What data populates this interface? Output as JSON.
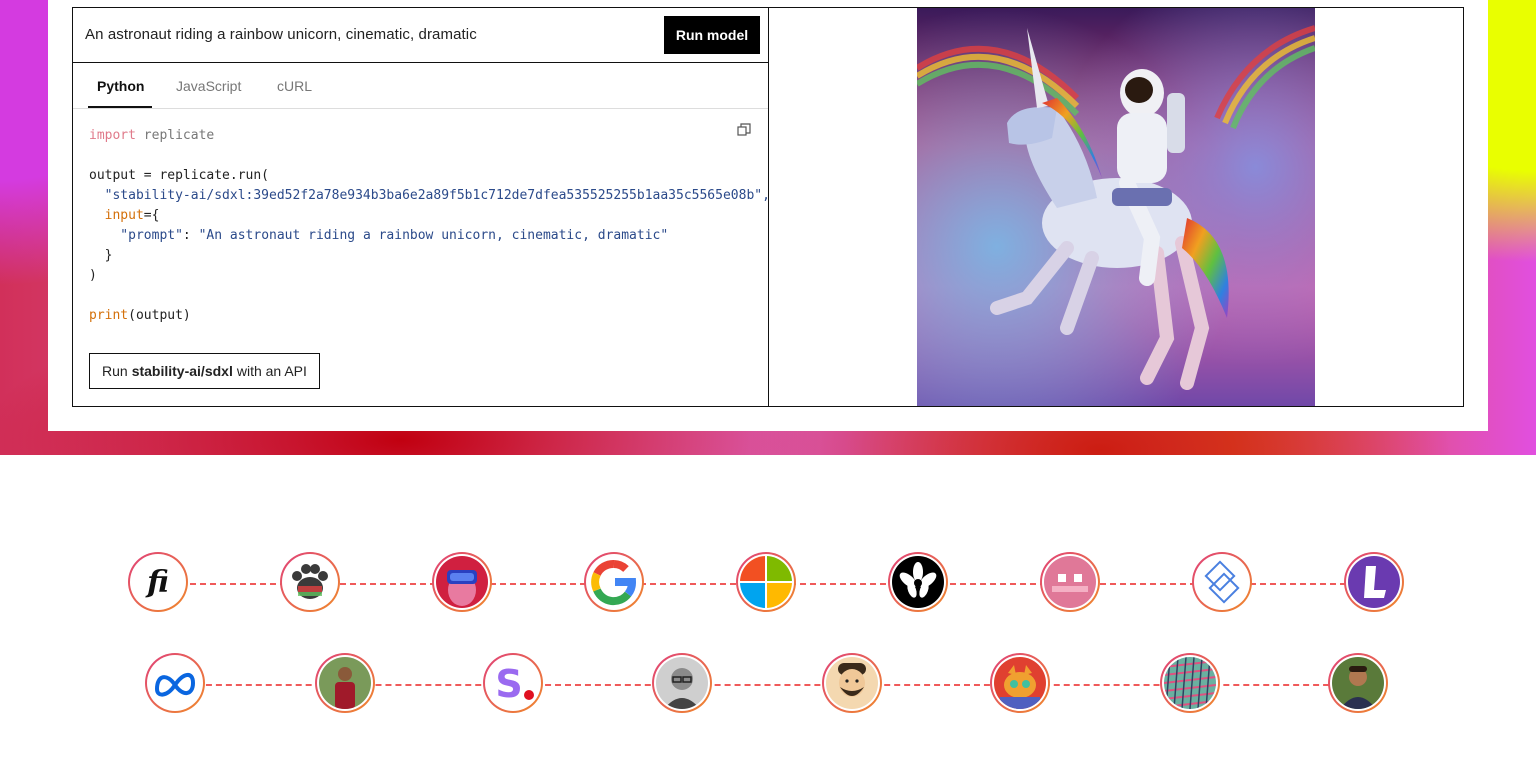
{
  "playground": {
    "prompt": "An astronaut riding a rainbow unicorn, cinematic, dramatic",
    "run_button": "Run model",
    "tabs": [
      "Python",
      "JavaScript",
      "cURL"
    ],
    "active_tab": "Python",
    "code": {
      "line1_kw": "import",
      "line1_mod": " replicate",
      "line2": "output = replicate.run(",
      "line3": "  \"stability-ai/sdxl:39ed52f2a78e934b3ba6e2a89f5b1c712de7dfea535525255b1aa35c5565e08b\",",
      "line4_a": "  ",
      "line4_kw": "input",
      "line4_b": "={",
      "line5_key": "    \"prompt\"",
      "line5_sep": ": ",
      "line5_val": "\"An astronaut riding a rainbow unicorn, cinematic, dramatic\"",
      "line6": "  }",
      "line7": ")",
      "line8_fn": "print",
      "line8_rest": "(output)"
    },
    "api_button": {
      "prefix": "Run",
      "model": "stability-ai/sdxl",
      "suffix": "with an API"
    }
  },
  "logos": {
    "row1": [
      "figma-like-fi-icon",
      "paw-icon",
      "vr-headset-avatar-icon",
      "google-icon",
      "microsoft-icon",
      "flower-icon",
      "pixel-face-icon",
      "interlocked-squares-icon",
      "letter-l-icon"
    ],
    "row2": [
      "meta-icon",
      "person-photo-icon",
      "letter-s-icon",
      "person-glasses-photo-icon",
      "bearded-avatar-icon",
      "cartoon-animal-icon",
      "pattern-icon",
      "person-smiling-photo-icon"
    ]
  },
  "colors": {
    "accent": "#000000",
    "dashed_line": "#f05a5a",
    "code_keyword": "#e07a8a",
    "code_string": "#2b4a8a",
    "code_function": "#d4700a"
  }
}
